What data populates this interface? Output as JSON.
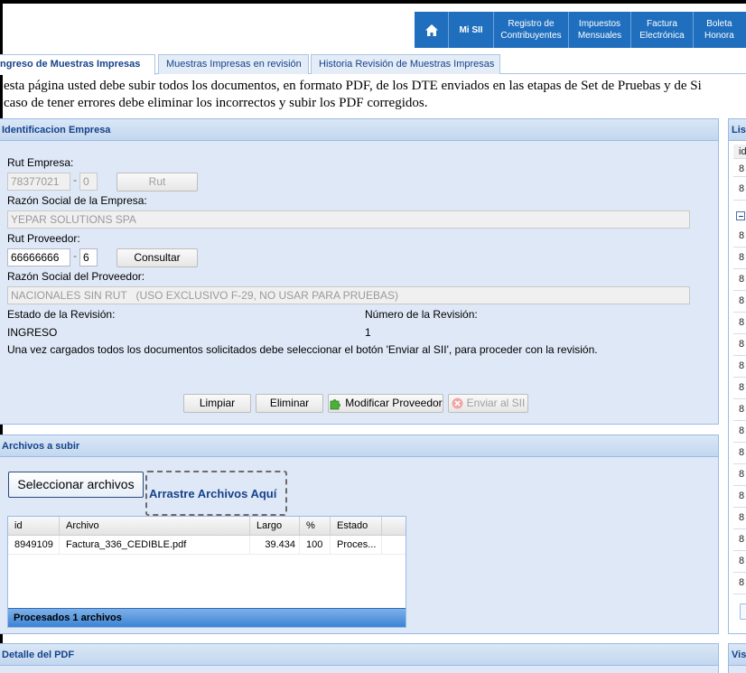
{
  "nav": {
    "items": [
      {
        "label": "Mi SII"
      },
      {
        "label": "Registro de\nContribuyentes"
      },
      {
        "label": "Impuestos\nMensuales"
      },
      {
        "label": "Factura\nElectrónica"
      },
      {
        "label": "Boleta\nHonora"
      }
    ]
  },
  "tabs": [
    {
      "label": "Ingreso de Muestras Impresas"
    },
    {
      "label": "Muestras Impresas en revisión"
    },
    {
      "label": "Historia Revisión de Muestras Impresas"
    }
  ],
  "intro": {
    "line1": "esta página usted debe subir todos los documentos, en formato PDF, de los DTE enviados en las etapas de Set de Pruebas y de Si",
    "line2": "caso de tener errores debe eliminar los incorrectos y subir los PDF corregidos."
  },
  "empresa": {
    "title": "Identificacion Empresa",
    "rut_label": "Rut Empresa:",
    "rut_value": "78377021",
    "dv_value": "0",
    "rut_button": "Rut",
    "razon_label": "Razón Social de la Empresa:",
    "razon_value": "YEPAR SOLUTIONS SPA",
    "prov_label": "Rut Proveedor:",
    "prov_value": "66666666",
    "prov_dv": "6",
    "consultar_button": "Consultar",
    "razon_prov_label": "Razón Social del Proveedor:",
    "razon_prov_value": "NACIONALES SIN RUT   (USO EXCLUSIVO F-29, NO USAR PARA PRUEBAS)",
    "estado_label": "Estado de la Revisión:",
    "estado_value": "INGRESO",
    "numero_label": "Número de la Revisión:",
    "numero_value": "1",
    "nota": "Una vez cargados todos los documentos solicitados debe seleccionar el botón 'Enviar al SII', para proceder con la revisión.",
    "buttons": {
      "limpiar": "Limpiar",
      "eliminar": "Eliminar",
      "modificar": "Modificar Proveedor",
      "enviar": "Enviar al SII"
    }
  },
  "archivos": {
    "title": "Archivos a subir",
    "select_button": "Seleccionar archivos",
    "drop_zone": "Arrastre Archivos Aquí",
    "columns": [
      "id",
      "Archivo",
      "Largo",
      "%",
      "Estado"
    ],
    "rows": [
      {
        "id": "8949109",
        "archivo": "Factura_336_CEDIBLE.pdf",
        "largo": "39.434",
        "pct": "100",
        "estado": "Proces..."
      }
    ],
    "footer": "Procesados 1 archivos"
  },
  "detalle": {
    "title": "Detalle del PDF"
  },
  "right": {
    "list_title": "Lis",
    "col_id": "id",
    "cell_prefix": "8",
    "bottom_title": "Vis"
  },
  "colors": {
    "nav_blue": "#1f6fbe",
    "panel_bg": "#dfe8f6",
    "header_text": "#15428b",
    "grid_footer": "#3a83d6"
  }
}
